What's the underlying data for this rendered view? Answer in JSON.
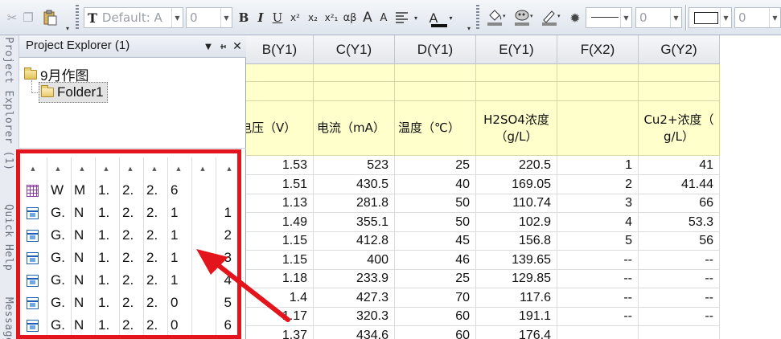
{
  "toolbar": {
    "font_name": "Default: A",
    "font_size": "0",
    "line_width": "0",
    "border_width": "0",
    "buttons": {
      "bold": "B",
      "italic": "I",
      "underline": "U",
      "superscript": "x²",
      "subscript": "x₂",
      "sup_sub": "x²₁",
      "greek": "αβ",
      "increase_font": "A",
      "decrease_font": "A",
      "font_color": "A"
    }
  },
  "side_strip": {
    "project_explorer_tab": "Project Explorer (1)",
    "quick_help_tab": "Quick Help",
    "messages_tab": "Messages"
  },
  "explorer": {
    "title": "Project Explorer (1)",
    "root_folder": "9月作图",
    "child_folder": "Folder1",
    "rows": [
      {
        "icon": "matrix-icon",
        "c1": "W",
        "c2": "M",
        "c3": "1.",
        "c4": "2.",
        "c5": "2.",
        "c6": "6",
        "c7": ""
      },
      {
        "icon": "graph-window-icon",
        "c1": "G.",
        "c2": "N",
        "c3": "1.",
        "c4": "2.",
        "c5": "2.",
        "c6": "1",
        "c7": "1"
      },
      {
        "icon": "graph-window-icon",
        "c1": "G.",
        "c2": "N",
        "c3": "1.",
        "c4": "2.",
        "c5": "2.",
        "c6": "1",
        "c7": "2"
      },
      {
        "icon": "graph-window-icon",
        "c1": "G.",
        "c2": "N",
        "c3": "1.",
        "c4": "2.",
        "c5": "2.",
        "c6": "1",
        "c7": "3"
      },
      {
        "icon": "graph-window-icon",
        "c1": "G.",
        "c2": "N",
        "c3": "1.",
        "c4": "2.",
        "c5": "2.",
        "c6": "1",
        "c7": "4"
      },
      {
        "icon": "graph-window-icon",
        "c1": "G.",
        "c2": "N",
        "c3": "1.",
        "c4": "2.",
        "c5": "2.",
        "c6": "0",
        "c7": "5"
      },
      {
        "icon": "graph-window-icon",
        "c1": "G.",
        "c2": "N",
        "c3": "1.",
        "c4": "2.",
        "c5": "2.",
        "c6": "0",
        "c7": "6"
      }
    ]
  },
  "sheet": {
    "columns": [
      "B(Y1)",
      "C(Y1)",
      "D(Y1)",
      "E(Y1)",
      "F(X2)",
      "G(Y2)"
    ],
    "long_names": [
      "电压（V）",
      "电流（mA）",
      "温度（℃）",
      "H2SO4浓度\n（g/L）",
      "",
      "Cu2+浓度（\ng/L）"
    ],
    "rows": [
      [
        "1.53",
        "523",
        "25",
        "220.5",
        "1",
        "41"
      ],
      [
        "1.51",
        "430.5",
        "40",
        "169.05",
        "2",
        "41.44"
      ],
      [
        "1.13",
        "281.8",
        "50",
        "110.74",
        "3",
        "66"
      ],
      [
        "1.49",
        "355.1",
        "50",
        "102.9",
        "4",
        "53.3"
      ],
      [
        "1.15",
        "412.8",
        "45",
        "156.8",
        "5",
        "56"
      ],
      [
        "1.15",
        "400",
        "46",
        "139.65",
        "--",
        "--"
      ],
      [
        "1.18",
        "233.9",
        "25",
        "129.85",
        "--",
        "--"
      ],
      [
        "1.4",
        "427.3",
        "70",
        "117.6",
        "--",
        "--"
      ],
      [
        "1.17",
        "320.3",
        "60",
        "191.1",
        "--",
        "--"
      ],
      [
        "1.37",
        "434.6",
        "60",
        "176.4",
        "",
        ""
      ]
    ]
  },
  "colors": {
    "highlight_box": "#e3141b",
    "arrow": "#e3141b",
    "meta_row_bg": "#ffffcc"
  }
}
